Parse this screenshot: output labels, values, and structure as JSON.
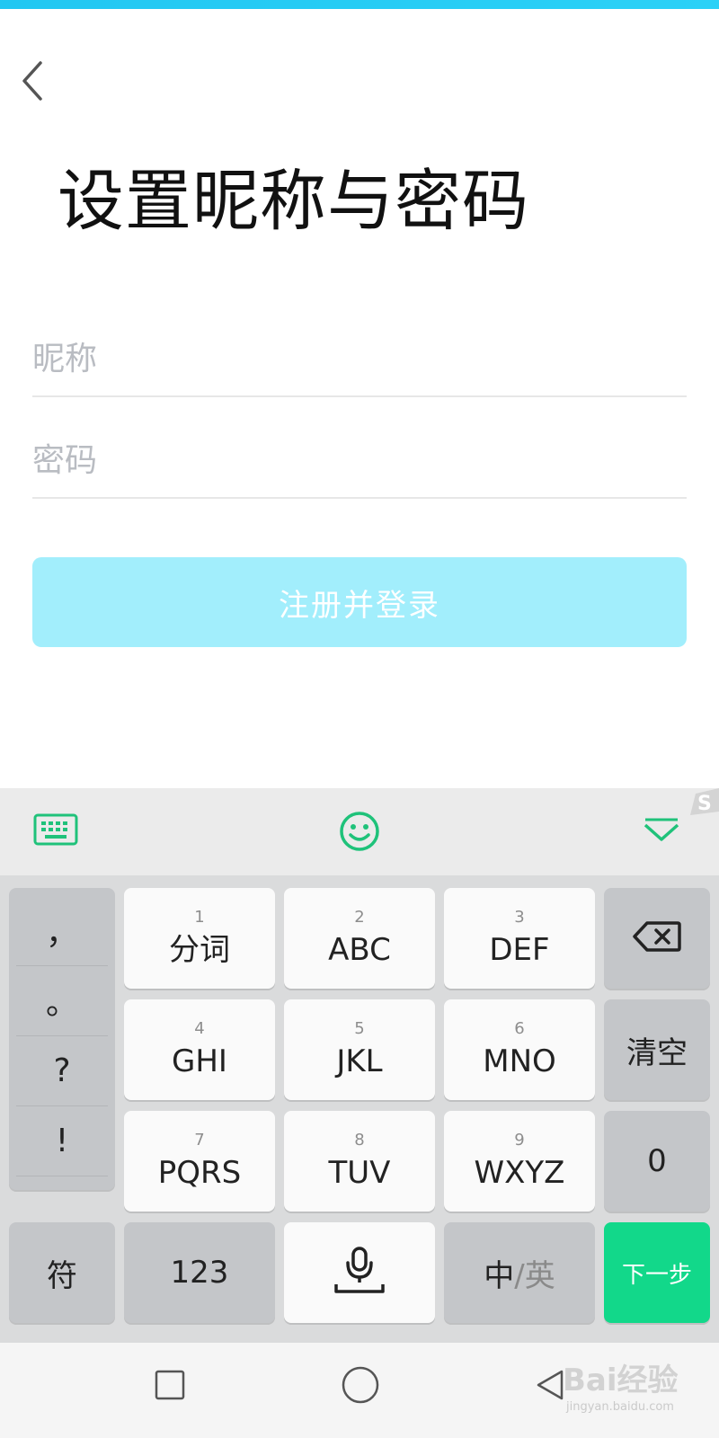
{
  "page": {
    "title": "设置昵称与密码"
  },
  "form": {
    "nickname_placeholder": "昵称",
    "password_placeholder": "密码",
    "submit_label": "注册并登录"
  },
  "keyboard": {
    "punctuation": [
      "，",
      "。",
      "?",
      "!"
    ],
    "rows": [
      [
        {
          "num": "1",
          "label": "分词"
        },
        {
          "num": "2",
          "label": "ABC"
        },
        {
          "num": "3",
          "label": "DEF"
        }
      ],
      [
        {
          "num": "4",
          "label": "GHI"
        },
        {
          "num": "5",
          "label": "JKL"
        },
        {
          "num": "6",
          "label": "MNO"
        }
      ],
      [
        {
          "num": "7",
          "label": "PQRS"
        },
        {
          "num": "8",
          "label": "TUV"
        },
        {
          "num": "9",
          "label": "WXYZ"
        }
      ]
    ],
    "clear_label": "清空",
    "zero_label": "0",
    "symbol_label": "符",
    "numeric_label": "123",
    "lang_primary": "中",
    "lang_secondary": "/英",
    "next_label": "下一步"
  },
  "watermark": {
    "logo": "Bai经验",
    "url": "jingyan.baidu.com"
  },
  "colors": {
    "accent": "#12d88a",
    "button_disabled": "#a2eefc",
    "status_strip": "#22c7f2"
  },
  "icons": [
    "back-icon",
    "keyboard-icon",
    "emoji-icon",
    "collapse-icon",
    "backspace-icon",
    "mic-icon",
    "square-icon",
    "circle-icon",
    "triangle-icon"
  ]
}
